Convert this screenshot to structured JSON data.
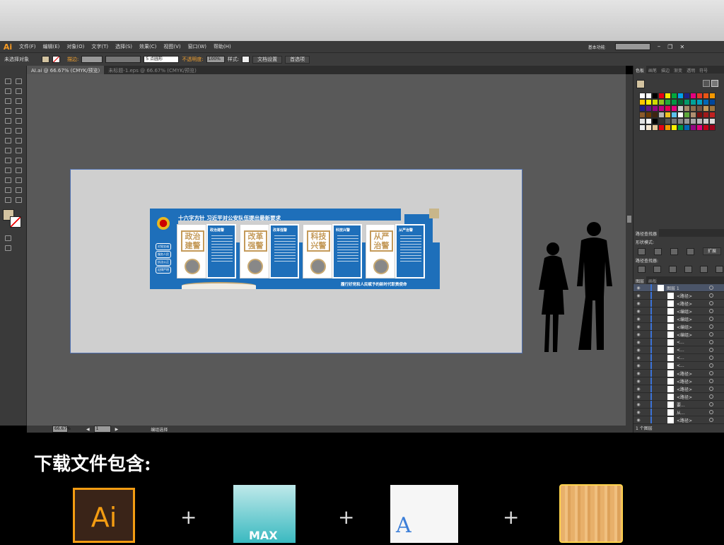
{
  "app": {
    "logo": "Ai",
    "menu": [
      "文件(F)",
      "编辑(E)",
      "对象(O)",
      "文字(T)",
      "选择(S)",
      "效果(C)",
      "视图(V)",
      "窗口(W)",
      "帮助(H)"
    ],
    "workspace": "基本功能",
    "search_placeholder": ""
  },
  "control": {
    "selection": "未选择对象",
    "stroke_label": "描边:",
    "brush": "5 点圆形",
    "opacity_label": "不透明度:",
    "opacity": "100%",
    "style_label": "样式:",
    "doc_setup": "文档设置",
    "prefs": "首选项"
  },
  "tabs": [
    {
      "label": "AI.ai @ 66.67% (CMYK/预览)",
      "active": true
    },
    {
      "label": "未标题-1.eps @ 66.67% (CMYK/预览)",
      "active": false
    }
  ],
  "status": {
    "zoom": "66.67%",
    "page": "1",
    "tool": "编组选择"
  },
  "swatches": {
    "tabs": [
      "色板",
      "画笔",
      "描边",
      "渐变",
      "透明",
      "符号"
    ],
    "colors": [
      "#ffffff",
      "#ffffff",
      "#000000",
      "#e60012",
      "#f6ea00",
      "#00a73c",
      "#00a0e9",
      "#1d2088",
      "#e4007f",
      "#e83828",
      "#ea5514",
      "#f39800",
      "#fcc800",
      "#fff100",
      "#cfdb00",
      "#8fc31f",
      "#22ac38",
      "#009944",
      "#006934",
      "#009b6b",
      "#00a29a",
      "#00a0c1",
      "#0068b7",
      "#00479d",
      "#1d2088",
      "#601986",
      "#920783",
      "#be0081",
      "#e5004f",
      "#e4007f",
      "#c9caca",
      "#a68c6c",
      "#8c6e4f",
      "#735545",
      "#c49a5a",
      "#a0763f",
      "#8a5a2b",
      "#6a3906",
      "#3e2410",
      "#b5b5b5",
      "#f0c020",
      "#5bc0eb",
      "#ffffff",
      "#5ea83b",
      "#b09070",
      "#7a1010",
      "#a01a1a",
      "#c02020",
      "#e0e0e0",
      "#f5f5f5",
      "#000000",
      "#333333",
      "#555555",
      "#777777",
      "#888888",
      "#999999",
      "#aaaaaa",
      "#bbbbbb",
      "#cccccc",
      "#dddddd",
      "#eeeeee",
      "#f5e6d0",
      "#e6c89a",
      "#e60012",
      "#f39800",
      "#fff100",
      "#009944",
      "#0068b7",
      "#920783",
      "#e4007f",
      "#c4001a",
      "#a0001a"
    ]
  },
  "pathfinder": {
    "title": "路径查找器",
    "shape_modes": "形状模式:",
    "expand": "扩展",
    "pathfinders": "路径查找器:"
  },
  "layers": {
    "tabs": [
      "图层",
      "画板"
    ],
    "count": "1 个图层",
    "items": [
      "图层 1",
      "<路径>",
      "<路径>",
      "<编组>",
      "<编组>",
      "<编组>",
      "<编组>",
      "<...",
      "<...",
      "<...",
      "<...",
      "<路径>",
      "<路径>",
      "<路径>",
      "<路径>",
      "要...",
      "从...",
      "<路径>"
    ]
  },
  "artwork": {
    "title": "十六字方针 习近平对公安队伍提出最新要求",
    "sections": [
      {
        "slogan": "政治建警",
        "heading": "政治建警"
      },
      {
        "slogan": "改革强警",
        "heading": "改革强警"
      },
      {
        "slogan": "科技兴警",
        "heading": "科技兴警"
      },
      {
        "slogan": "从严治警",
        "heading": "从严治警"
      }
    ],
    "side_buttons": [
      "对党忠诚",
      "服务人民",
      "执法公正",
      "纪律严明"
    ],
    "footer": "履行好党和人民赋予的新时代职责使命"
  },
  "download": {
    "title": "下载文件包含:",
    "items": [
      "Ai",
      "MAX",
      "A",
      ""
    ],
    "plus": "+"
  }
}
